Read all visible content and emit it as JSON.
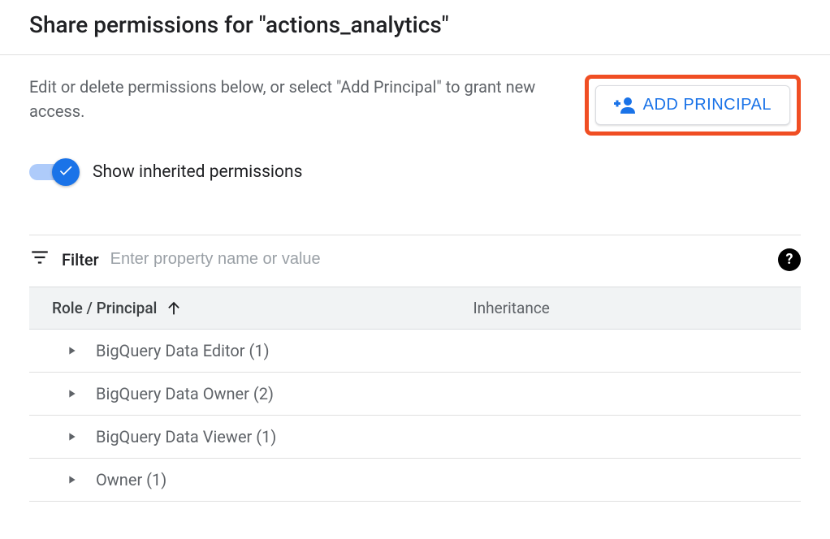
{
  "title": "Share permissions for \"actions_analytics\"",
  "description": "Edit or delete permissions below, or select \"Add Principal\" to grant new access.",
  "add_button_label": "ADD PRINCIPAL",
  "toggle": {
    "label": "Show inherited permissions",
    "enabled": true
  },
  "filter": {
    "label": "Filter",
    "placeholder": "Enter property name or value"
  },
  "table": {
    "columns": {
      "role": "Role / Principal",
      "inheritance": "Inheritance"
    },
    "sort": {
      "column": "role",
      "direction": "asc"
    },
    "rows": [
      {
        "label": "BigQuery Data Editor (1)"
      },
      {
        "label": "BigQuery Data Owner (2)"
      },
      {
        "label": "BigQuery Data Viewer (1)"
      },
      {
        "label": "Owner (1)"
      }
    ]
  }
}
